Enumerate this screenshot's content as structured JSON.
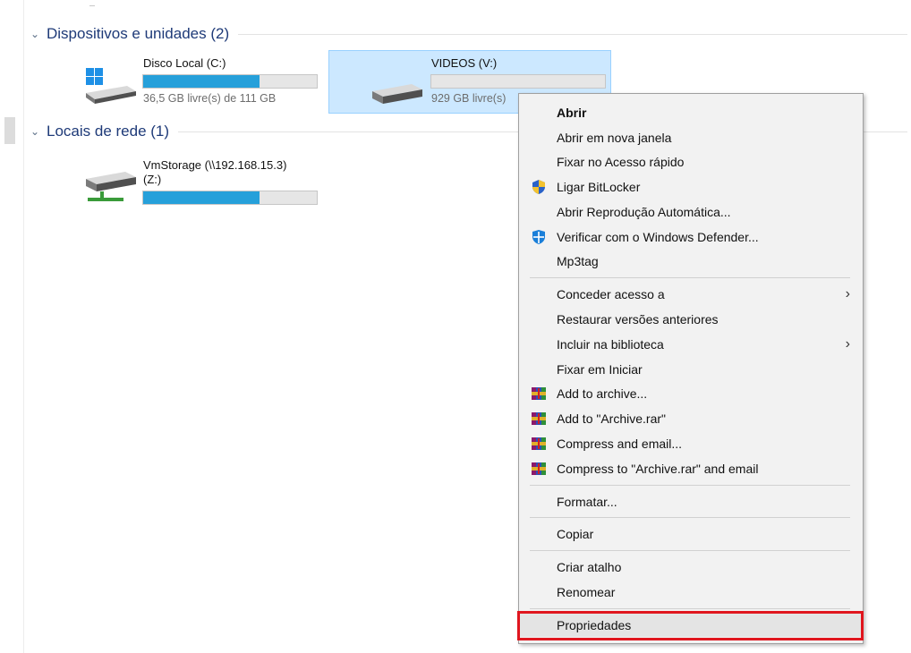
{
  "groups": {
    "devices": {
      "title": "Dispositivos e unidades (2)"
    },
    "network": {
      "title": "Locais de rede (1)"
    }
  },
  "drives": [
    {
      "name": "Disco Local (C:)",
      "free_text": "36,5 GB livre(s) de 111 GB",
      "used_fraction": 0.67,
      "icon": "windows-drive-icon"
    },
    {
      "name": "VIDEOS (V:)",
      "free_text": "929 GB livre(s)",
      "used_fraction": 0.0,
      "icon": "hard-drive-icon",
      "selected": true
    },
    {
      "name_line1": "VmStorage (\\\\192.168.15.3)",
      "name_line2": "(Z:)",
      "used_fraction": 0.67,
      "icon": "network-drive-icon"
    }
  ],
  "context_menu": {
    "items": [
      {
        "label": "Abrir",
        "bold": true
      },
      {
        "label": "Abrir em nova janela"
      },
      {
        "label": "Fixar no Acesso rápido"
      },
      {
        "label": "Ligar BitLocker",
        "icon": "bitlocker-shield-icon"
      },
      {
        "label": "Abrir Reprodução Automática..."
      },
      {
        "label": "Verificar com o Windows Defender...",
        "icon": "windows-defender-icon"
      },
      {
        "label": "Mp3tag"
      },
      {
        "label": "Conceder acesso a",
        "submenu": true
      },
      {
        "label": "Restaurar versões anteriores"
      },
      {
        "label": "Incluir na biblioteca",
        "submenu": true
      },
      {
        "label": "Fixar em Iniciar"
      },
      {
        "label": "Add to archive...",
        "icon": "winrar-icon"
      },
      {
        "label": "Add to \"Archive.rar\"",
        "icon": "winrar-icon"
      },
      {
        "label": "Compress and email...",
        "icon": "winrar-icon"
      },
      {
        "label": "Compress to \"Archive.rar\" and email",
        "icon": "winrar-icon"
      },
      {
        "label": "Formatar..."
      },
      {
        "label": "Copiar"
      },
      {
        "label": "Criar atalho"
      },
      {
        "label": "Renomear"
      },
      {
        "label": "Propriedades",
        "highlighted": true
      }
    ]
  },
  "colors": {
    "accent_fill": "#26a0da",
    "selection_bg": "#cce8ff",
    "highlight_border": "#e0161e",
    "group_title": "#1e3a78"
  }
}
